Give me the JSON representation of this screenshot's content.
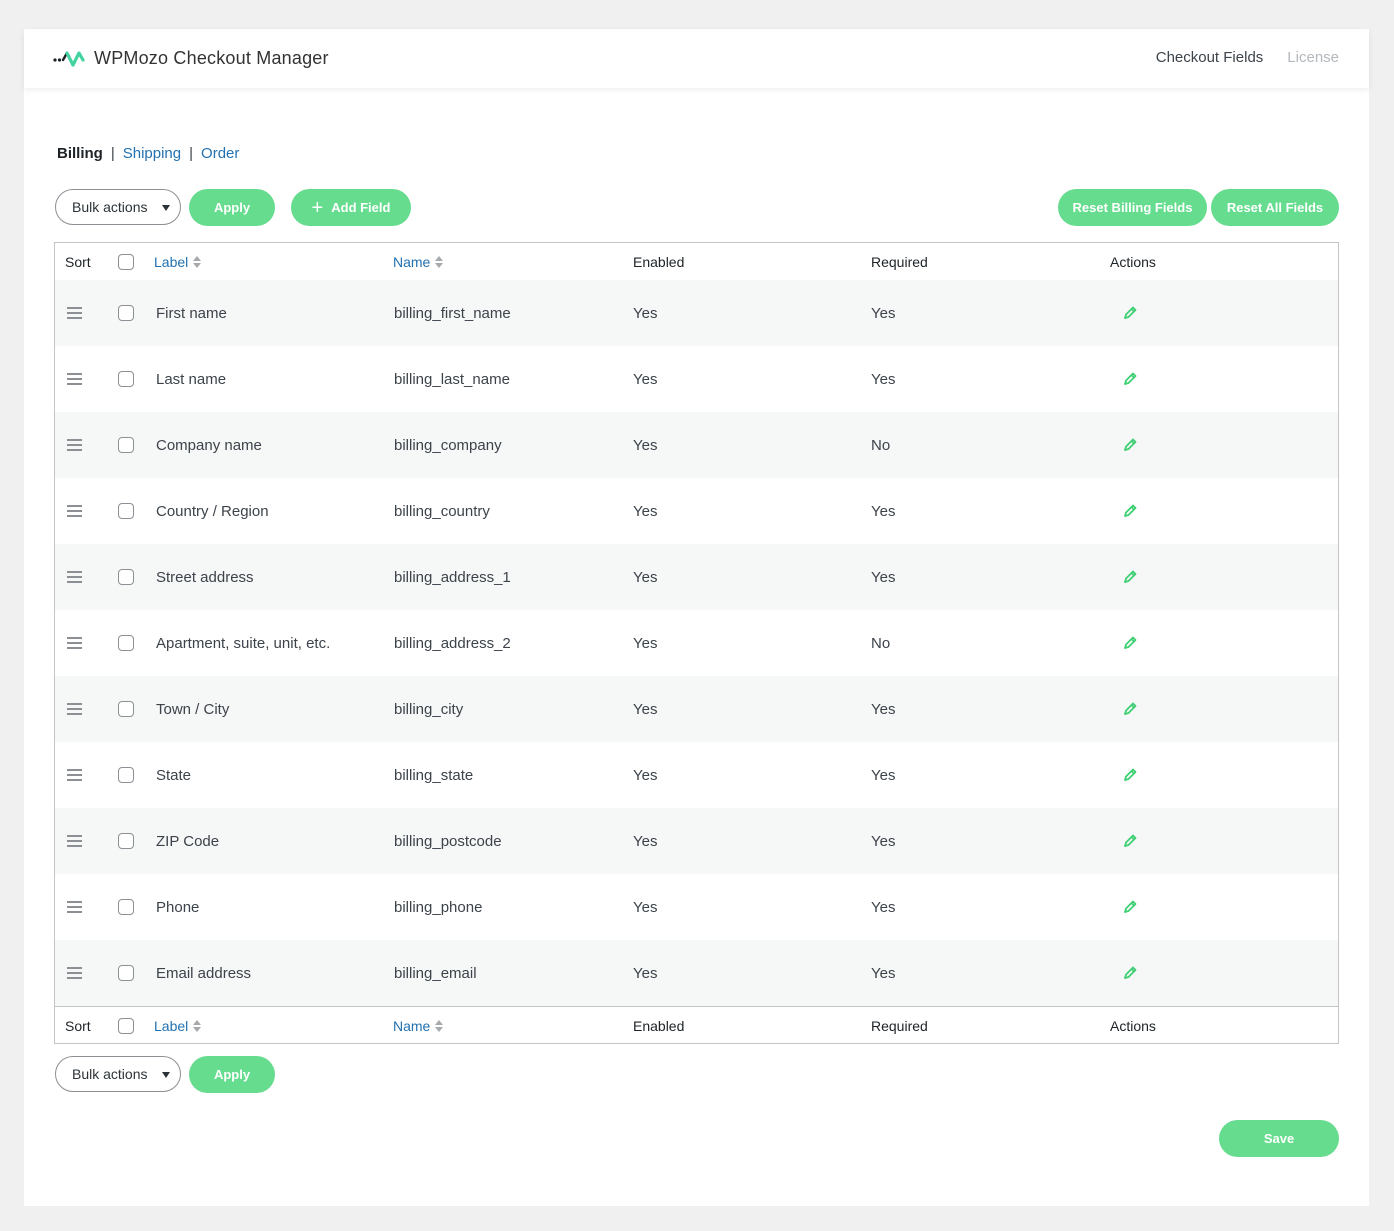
{
  "app": {
    "title": "WPMozo Checkout Manager"
  },
  "top_nav": {
    "checkout_fields": "Checkout Fields",
    "license": "License"
  },
  "sub_nav": {
    "billing": "Billing",
    "separator": "|",
    "shipping": "Shipping",
    "order": "Order"
  },
  "toolbar": {
    "bulk_actions": "Bulk actions",
    "apply": "Apply",
    "add_field": "Add Field",
    "reset_billing": "Reset Billing Fields",
    "reset_all": "Reset All Fields"
  },
  "table": {
    "columns": {
      "sort": "Sort",
      "label": "Label",
      "name": "Name",
      "enabled": "Enabled",
      "required": "Required",
      "actions": "Actions"
    },
    "rows": [
      {
        "label": "First name",
        "name": "billing_first_name",
        "enabled": "Yes",
        "required": "Yes"
      },
      {
        "label": "Last name",
        "name": "billing_last_name",
        "enabled": "Yes",
        "required": "Yes"
      },
      {
        "label": "Company name",
        "name": "billing_company",
        "enabled": "Yes",
        "required": "No"
      },
      {
        "label": "Country / Region",
        "name": "billing_country",
        "enabled": "Yes",
        "required": "Yes"
      },
      {
        "label": "Street address",
        "name": "billing_address_1",
        "enabled": "Yes",
        "required": "Yes"
      },
      {
        "label": "Apartment, suite, unit, etc.",
        "name": "billing_address_2",
        "enabled": "Yes",
        "required": "No"
      },
      {
        "label": "Town / City",
        "name": "billing_city",
        "enabled": "Yes",
        "required": "Yes"
      },
      {
        "label": "State",
        "name": "billing_state",
        "enabled": "Yes",
        "required": "Yes"
      },
      {
        "label": "ZIP Code",
        "name": "billing_postcode",
        "enabled": "Yes",
        "required": "Yes"
      },
      {
        "label": "Phone",
        "name": "billing_phone",
        "enabled": "Yes",
        "required": "Yes"
      },
      {
        "label": "Email address",
        "name": "billing_email",
        "enabled": "Yes",
        "required": "Yes"
      }
    ]
  },
  "bottom_toolbar": {
    "bulk_actions": "Bulk actions",
    "apply": "Apply"
  },
  "save": "Save",
  "colors": {
    "accent": "#66dc8e",
    "link": "#2271b1",
    "background": "#f0f0f1",
    "row_stripe": "#f6f7f7"
  },
  "icons": {
    "logo": "wpmozo-logo-icon",
    "drag": "drag-handle-icon",
    "edit": "pencil-icon",
    "add": "plus-icon",
    "sort": "sort-arrows-icon",
    "dropdown": "caret-down-icon"
  }
}
